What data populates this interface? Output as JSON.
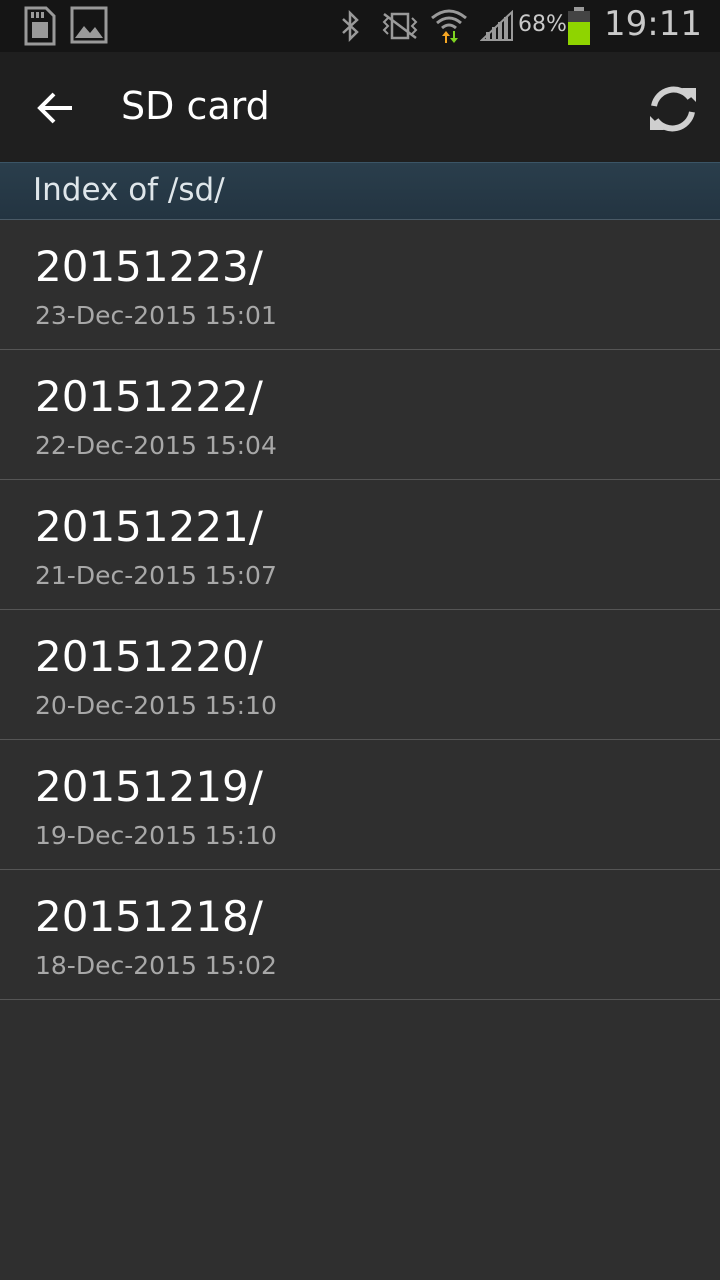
{
  "status_bar": {
    "battery_percent": "68%",
    "battery_level": 0.68,
    "time": "19:11",
    "icons": [
      "sim-card-icon",
      "gallery-icon",
      "bluetooth-icon",
      "vibrate-icon",
      "wifi-icon",
      "signal-icon",
      "battery-icon"
    ],
    "battery_color": "#8fd400",
    "wifi_up_color": "#7ed321",
    "wifi_down_color": "#f5a623"
  },
  "app_bar": {
    "title": "SD card",
    "back_icon": "arrow-left-icon",
    "refresh_icon": "refresh-icon"
  },
  "index_header": "Index of /sd/",
  "entries": [
    {
      "name": "20151223/",
      "date": "23-Dec-2015 15:01"
    },
    {
      "name": "20151222/",
      "date": "22-Dec-2015 15:04"
    },
    {
      "name": "20151221/",
      "date": "21-Dec-2015 15:07"
    },
    {
      "name": "20151220/",
      "date": "20-Dec-2015 15:10"
    },
    {
      "name": "20151219/",
      "date": "19-Dec-2015 15:10"
    },
    {
      "name": "20151218/",
      "date": "18-Dec-2015 15:02"
    }
  ]
}
